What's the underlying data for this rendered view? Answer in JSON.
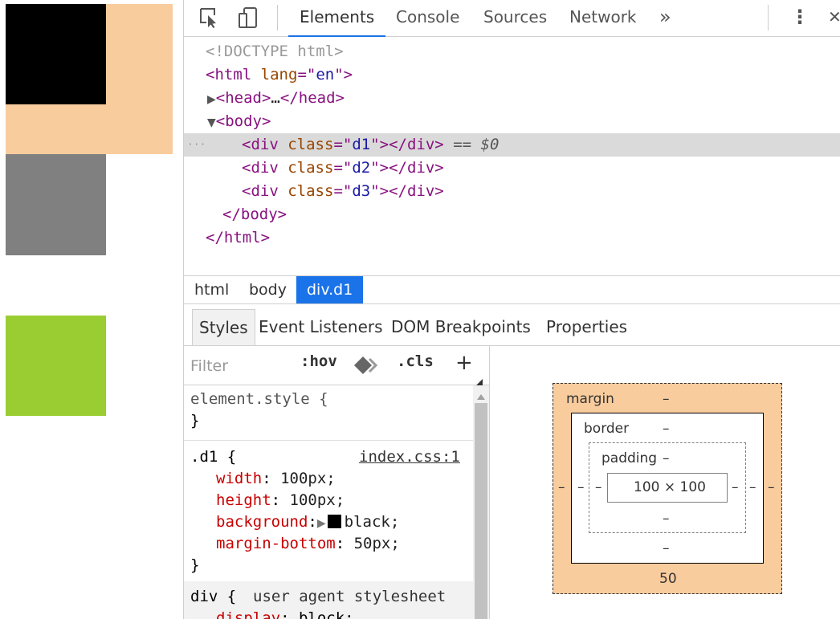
{
  "toolbar": {
    "inspect_icon": "cursor-select-icon",
    "device_icon": "device-toggle-icon",
    "tabs": [
      "Elements",
      "Console",
      "Sources",
      "Network"
    ],
    "more_tabs": "»",
    "menu_glyph": "⋮",
    "close_glyph": "✕"
  },
  "dom": {
    "doctype": "<!DOCTYPE html>",
    "html_open_tag": "html",
    "lang_attr": "lang",
    "lang_value": "en",
    "head_collapsed": "…",
    "body_tag": "body",
    "div_tag": "div",
    "class_attr": "class",
    "d1": "d1",
    "d2": "d2",
    "d3": "d3",
    "selected_marker": "== $0",
    "dots": "···"
  },
  "breadcrumbs": [
    "html",
    "body",
    "div.d1"
  ],
  "subtabs": [
    "Styles",
    "Event Listeners",
    "DOM Breakpoints",
    "Properties"
  ],
  "styles": {
    "filter_placeholder": "Filter",
    "hov": ":hov",
    "cls": ".cls",
    "plus": "+",
    "element_style": "element.style {",
    "close_brace": "}",
    "d1_selector": ".d1 {",
    "d1_source": "index.css:1",
    "props": [
      {
        "name": "width",
        "value": "100px;"
      },
      {
        "name": "height",
        "value": "100px;"
      },
      {
        "name": "background",
        "value": "black;"
      },
      {
        "name": "margin-bottom",
        "value": "50px;"
      }
    ],
    "ua_selector": "div {",
    "ua_source": "user agent stylesheet"
  },
  "boxmodel": {
    "margin_label": "margin",
    "border_label": "border",
    "padding_label": "padding",
    "content": "100 × 100",
    "dash": "–",
    "margin_bottom": "50"
  },
  "colors": {
    "d1": "#000000",
    "d2": "#808080",
    "d3": "#9acd32",
    "margin_highlight": "#f9cc9d",
    "accent": "#1a73e8"
  }
}
